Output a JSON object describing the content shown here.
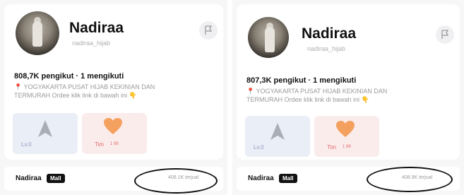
{
  "left": {
    "name": "Nadiraa",
    "handle": "nadiraa_hijab",
    "stats": "808,7K pengikut · 1 mengikuti",
    "bio_line1": "YOGYAKARTA PUSAT HIJAB KEKINIAN DAN",
    "bio_line2": "TERMURAH Ordee klik link di bawah ini",
    "level_label": "Lv.0",
    "team_label": "Tim",
    "team_sub": "1 99",
    "shop_name": "Nadiraa",
    "mall_badge": "Mall",
    "sold": "408.1K terjual",
    "chevron": "›"
  },
  "right": {
    "name": "Nadiraa",
    "handle": "nadiraa_hijab",
    "stats": "807,3K pengikut · 1 mengikuti",
    "bio_line1": "YOGYAKARTA PUSAT HIJAB KEKINIAN DAN",
    "bio_line2": "TERMURAH Ordee klik link di bawah ini",
    "level_label": "Lv.0",
    "team_label": "Tim",
    "team_sub": "1 99",
    "shop_name": "Nadiraa",
    "mall_badge": "Mall",
    "sold": "408.9K terjual",
    "chevron": "›"
  },
  "icons": {
    "pin": "📍",
    "hand": "👇",
    "flag": "flag-icon",
    "level": "arrow-level-icon",
    "heart": "heart-icon"
  },
  "colors": {
    "level_bg": "#eaeef6",
    "team_bg": "#fbecec",
    "heart": "#f4a160",
    "mall_bg": "#111111"
  }
}
